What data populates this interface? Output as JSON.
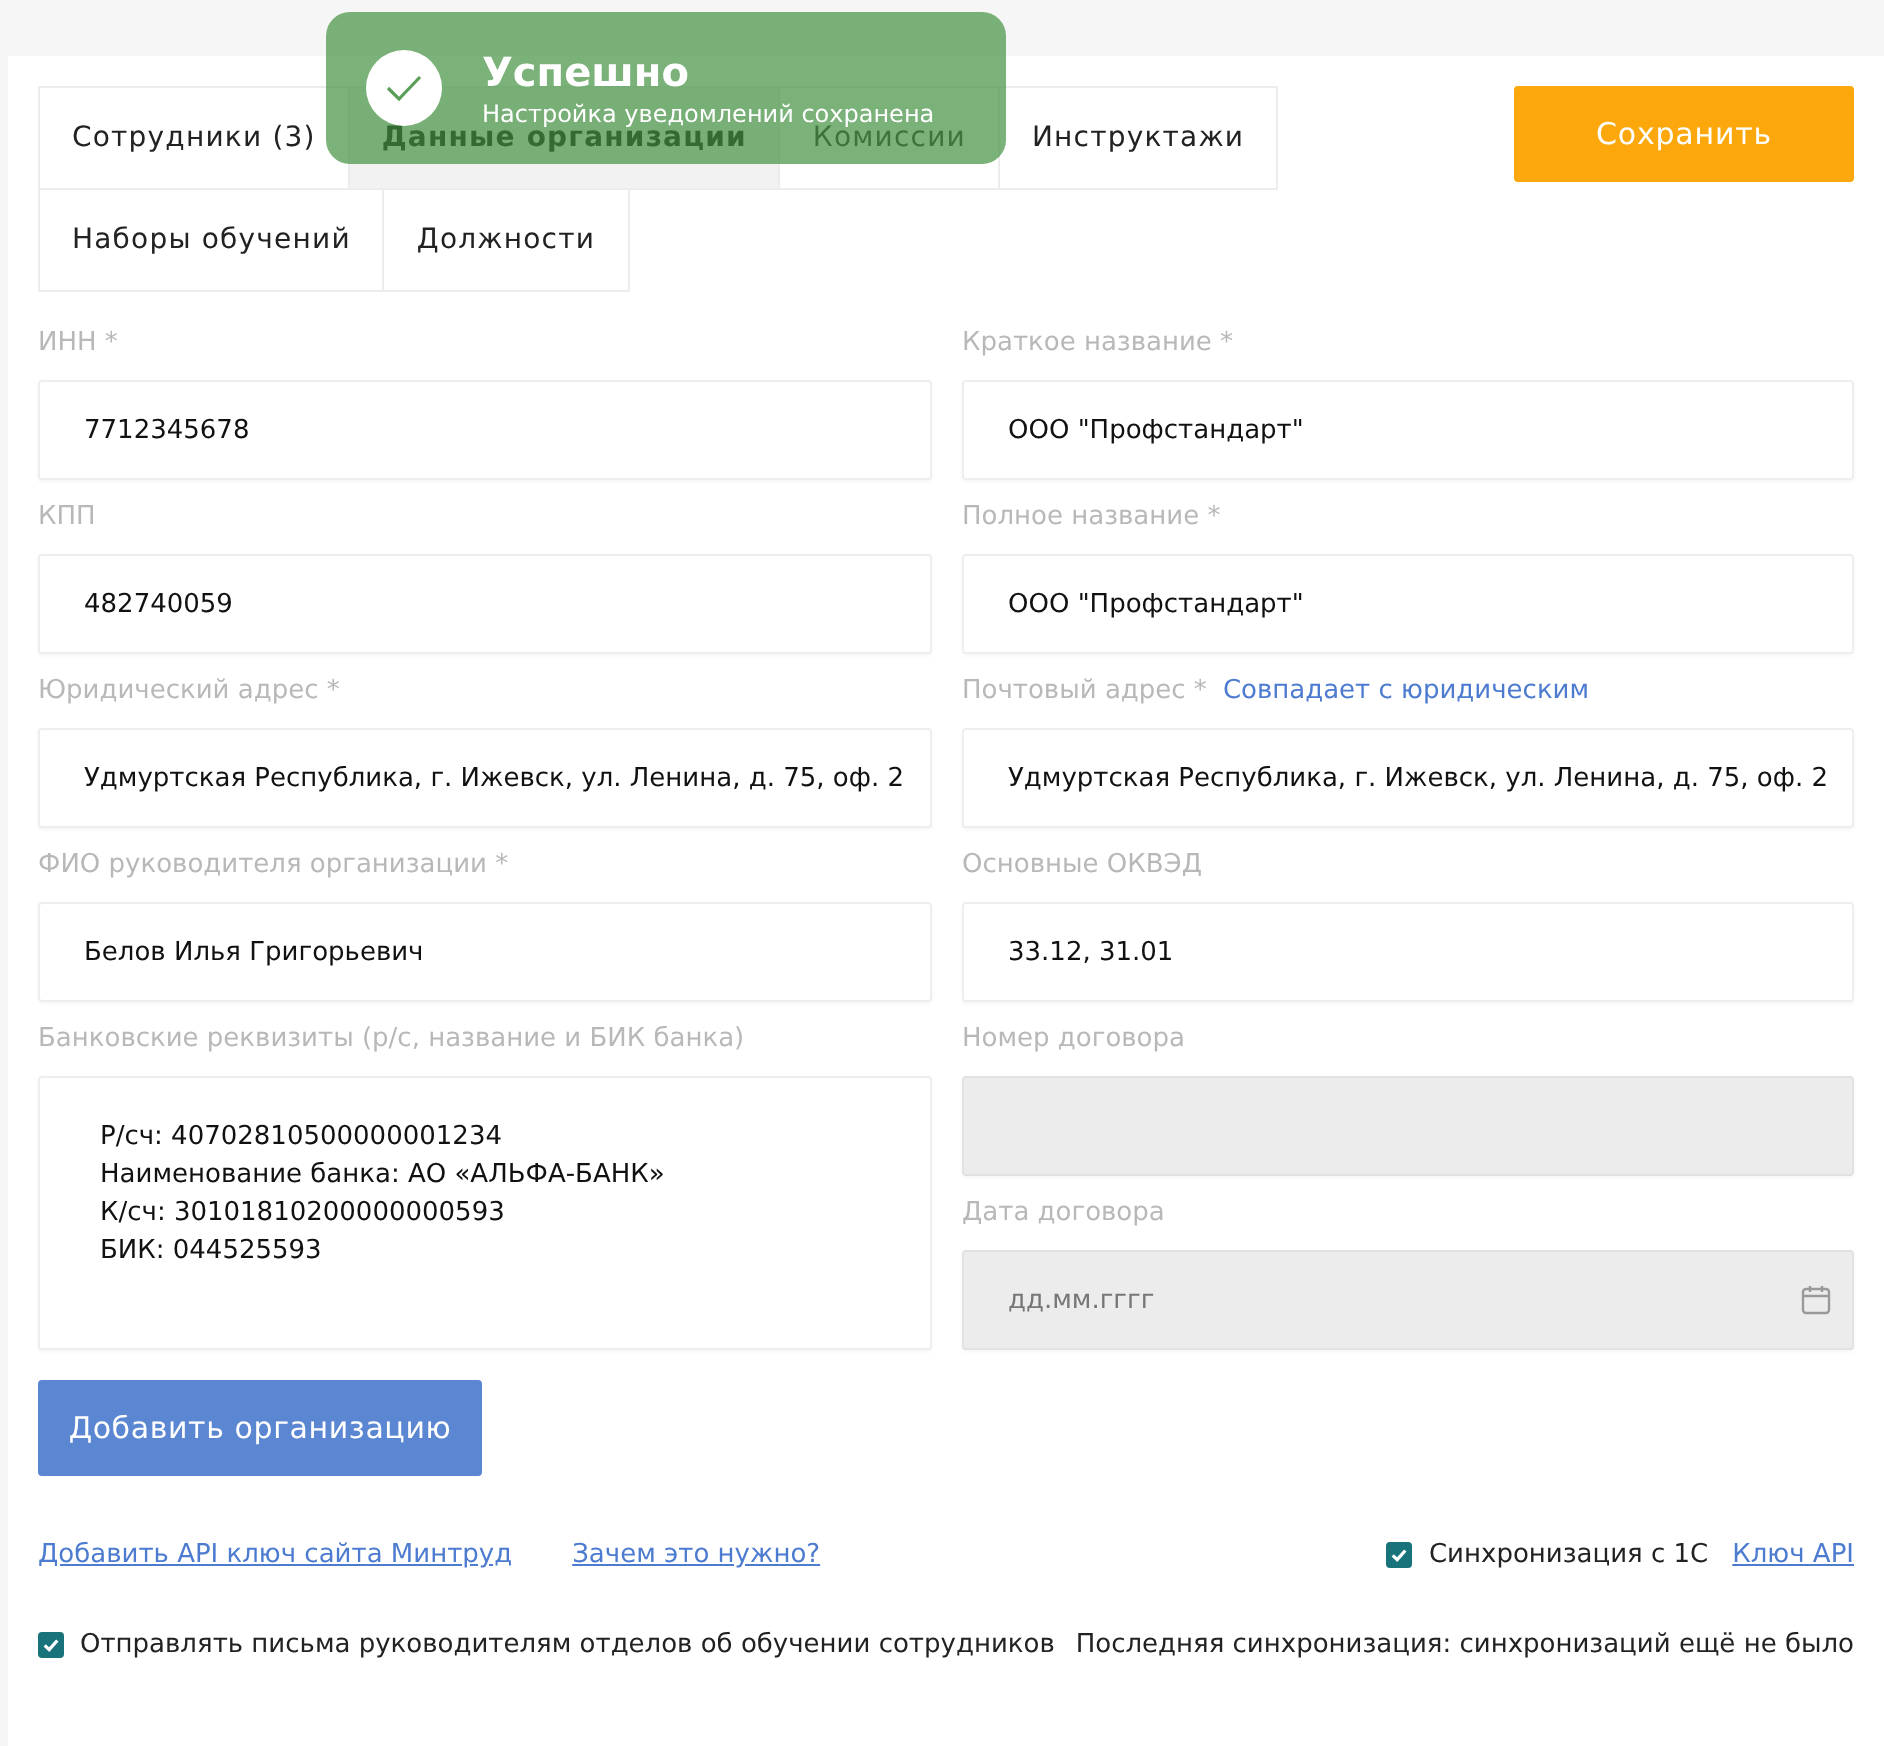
{
  "toast": {
    "title": "Успешно",
    "message": "Настройка уведомлений сохранена"
  },
  "tab_rows": [
    [
      {
        "label": "Сотрудники (3)",
        "selected": false
      },
      {
        "label": "Данные организации",
        "selected": true
      },
      {
        "label": "Комиссии",
        "selected": false
      },
      {
        "label": "Инструктажи",
        "selected": false
      }
    ],
    [
      {
        "label": "Наборы обучений",
        "selected": false
      },
      {
        "label": "Должности",
        "selected": false
      }
    ]
  ],
  "save_button": "Сохранить",
  "left_column": [
    {
      "kind": "text",
      "label": "ИНН *",
      "value": "7712345678",
      "disabled": false
    },
    {
      "kind": "text",
      "label": "КПП",
      "value": "482740059",
      "disabled": false
    },
    {
      "kind": "text",
      "label": "Юридический адрес *",
      "value": "Удмуртская Республика, г. Ижевск, ул. Ленина, д. 75, оф. 2",
      "disabled": false
    },
    {
      "kind": "text",
      "label": "ФИО руководителя организации *",
      "value": "Белов Илья Григорьевич",
      "disabled": false
    },
    {
      "kind": "textarea",
      "label": "Банковские реквизиты (р/с, название и БИК банка)",
      "value": "Р/сч: 40702810500000001234\nНаименование банка: АО «АЛЬФА-БАНК»\nК/сч: 30101810200000000593\nБИК: 044525593",
      "disabled": false
    }
  ],
  "right_column": [
    {
      "kind": "text",
      "label": "Краткое название *",
      "value": "ООО \"Профстандарт\"",
      "disabled": false
    },
    {
      "kind": "text",
      "label": "Полное название *",
      "value": "ООО \"Профстандарт\"",
      "disabled": false
    },
    {
      "kind": "text",
      "label": "Почтовый адрес *",
      "label_link": "Совпадает с юридическим",
      "value": "Удмуртская Республика, г. Ижевск, ул. Ленина, д. 75, оф. 2",
      "disabled": false
    },
    {
      "kind": "text",
      "label": "Основные ОКВЭД",
      "value": "33.12, 31.01",
      "disabled": false
    },
    {
      "kind": "text",
      "label": "Номер договора",
      "disabled": true
    },
    {
      "kind": "date",
      "label": "Дата договора",
      "placeholder": "дд.мм.гггг",
      "disabled": true
    }
  ],
  "add_button": "Добавить организацию",
  "links": [
    "Добавить API ключ сайта Минтруд",
    "Зачем это нужно?"
  ],
  "sync": {
    "label": "Синхронизация с 1С",
    "checked": true,
    "link": "Ключ API"
  },
  "notify": {
    "label": "Отправлять письма руководителям отделов об обучении сотрудников",
    "checked": true
  },
  "last_sync": "Последняя синхронизация: синхронизаций ещё не было"
}
